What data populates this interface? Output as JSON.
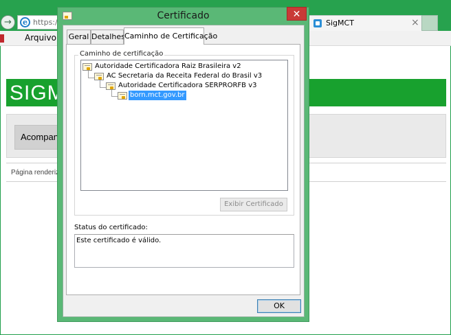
{
  "browser": {
    "address_text": "https://",
    "tab_title": "SigMCT",
    "tab_close": "×",
    "menu_arquivo": "Arquivo",
    "back_arrow": "→"
  },
  "page": {
    "banner_text": "SIGM",
    "acompan_label": "Acompan",
    "pagina_text": "Página renderiz"
  },
  "dialog": {
    "title": "Certificado",
    "close_symbol": "✕",
    "tabs": [
      {
        "label": "Geral"
      },
      {
        "label": "Detalhes"
      },
      {
        "label": "Caminho de Certificação"
      }
    ],
    "active_tab": "Caminho de Certificação",
    "path_group_label": "Caminho de certificação",
    "tree": [
      {
        "label": "Autoridade Certificadora Raiz Brasileira v2",
        "level": 0,
        "selected": false
      },
      {
        "label": "AC Secretaria da Receita Federal do Brasil v3",
        "level": 1,
        "selected": false
      },
      {
        "label": "Autoridade Certificadora SERPRORFB v3",
        "level": 2,
        "selected": false
      },
      {
        "label": "born.mct.gov.br",
        "level": 3,
        "selected": true
      }
    ],
    "view_cert_button": "Exibir Certificado",
    "status_label": "Status do certificado:",
    "status_text": "Este certificado é válido.",
    "ok_button": "OK"
  }
}
